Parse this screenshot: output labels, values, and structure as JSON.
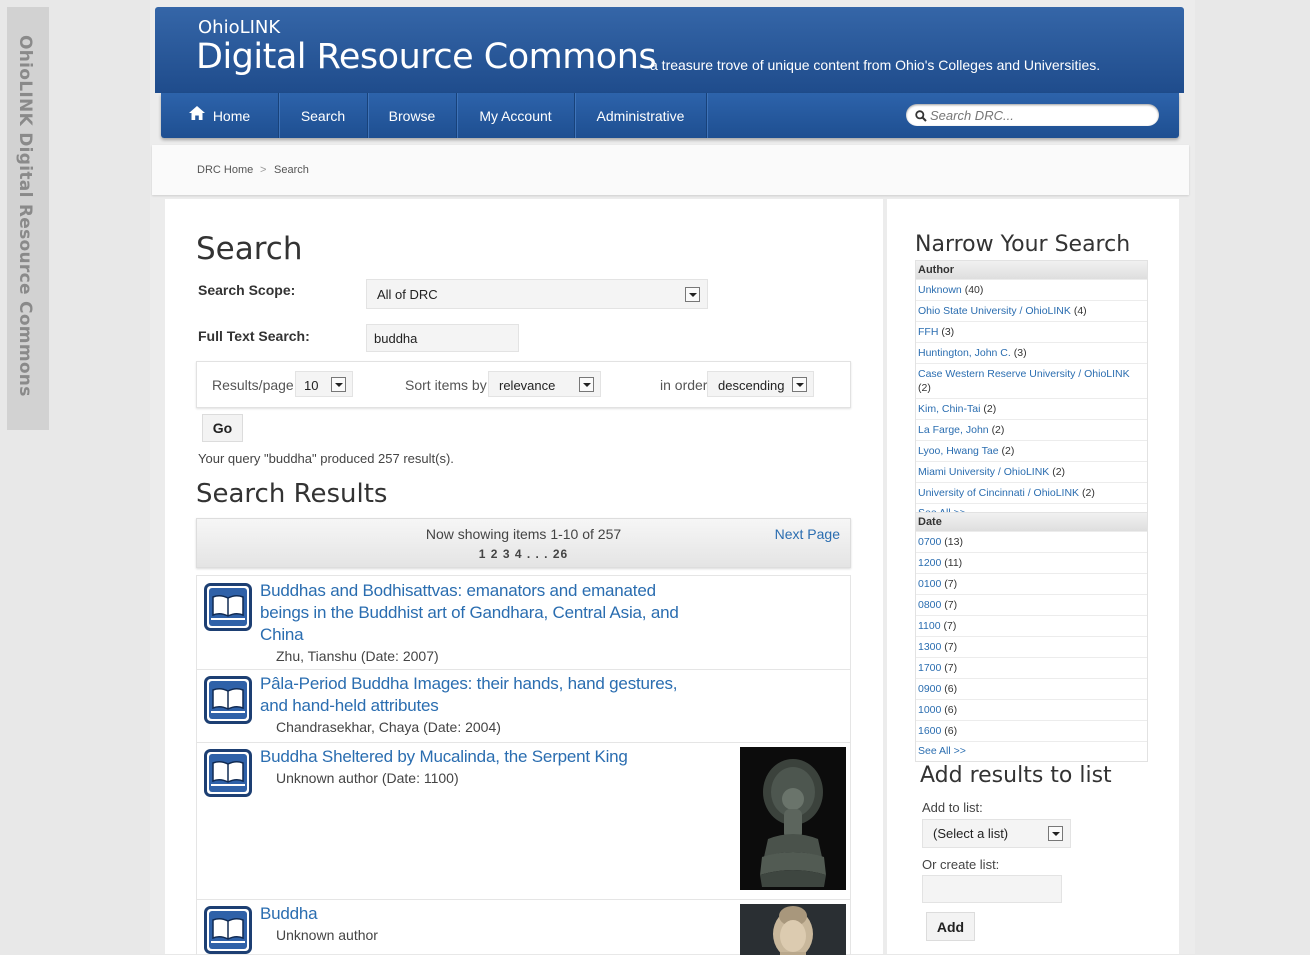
{
  "side_tab": {
    "label": "OhioLINK Digital Resource Commons"
  },
  "header": {
    "subtitle": "OhioLINK",
    "title": "Digital Resource Commons",
    "tagline": "a treasure trove of unique content from Ohio's Colleges and Universities."
  },
  "nav": {
    "items": [
      {
        "label": "Home",
        "icon": "home-icon"
      },
      {
        "label": "Search"
      },
      {
        "label": "Browse"
      },
      {
        "label": "My Account"
      },
      {
        "label": "Administrative"
      }
    ],
    "search_placeholder": "Search DRC..."
  },
  "breadcrumb": {
    "items": [
      "DRC Home",
      "Search"
    ],
    "separator": ">"
  },
  "search_form": {
    "heading": "Search",
    "scope_label": "Search Scope:",
    "scope_value": "All of DRC",
    "fulltext_label": "Full Text Search:",
    "fulltext_value": "buddha",
    "rpp_label": "Results/page",
    "rpp_value": "10",
    "sort_label": "Sort items by",
    "sort_value": "relevance",
    "order_label": "in order",
    "order_value": "descending",
    "go_label": "Go",
    "query_summary": "Your query \"buddha\" produced 257 result(s)."
  },
  "results": {
    "heading": "Search Results",
    "showing": "Now showing items 1-10 of 257",
    "pages": "1 2 3 4 . . . 26",
    "next_label": "Next Page",
    "items": [
      {
        "title": "Buddhas and Bodhisattvas: emanators and emanated beings in the Buddhist art of Gandhara, Central Asia, and China",
        "meta": "Zhu, Tianshu (Date: 2007)"
      },
      {
        "title": "Pâla-Period Buddha Images: their hands, hand gestures, and hand-held attributes",
        "meta": "Chandrasekhar, Chaya (Date: 2004)"
      },
      {
        "title": "Buddha Sheltered by Mucalinda, the Serpent King",
        "meta": "Unknown author (Date: 1100)"
      },
      {
        "title": "Buddha",
        "meta": "Unknown author"
      }
    ]
  },
  "narrow": {
    "heading": "Narrow Your Search",
    "author": {
      "label": "Author",
      "items": [
        {
          "name": "Unknown",
          "count": "(40)"
        },
        {
          "name": "Ohio State University / OhioLINK",
          "count": "(4)"
        },
        {
          "name": "FFH",
          "count": "(3)"
        },
        {
          "name": "Huntington, John C.",
          "count": "(3)"
        },
        {
          "name": "Case Western Reserve University / OhioLINK",
          "count": "(2)"
        },
        {
          "name": "Kim, Chin-Tai",
          "count": "(2)"
        },
        {
          "name": "La Farge, John",
          "count": "(2)"
        },
        {
          "name": "Lyoo, Hwang Tae",
          "count": "(2)"
        },
        {
          "name": "Miami University / OhioLINK",
          "count": "(2)"
        },
        {
          "name": "University of Cincinnati / OhioLINK",
          "count": "(2)"
        }
      ],
      "see_all": "See All >>"
    },
    "date": {
      "label": "Date",
      "items": [
        {
          "name": "0700",
          "count": "(13)"
        },
        {
          "name": "1200",
          "count": "(11)"
        },
        {
          "name": "0100",
          "count": "(7)"
        },
        {
          "name": "0800",
          "count": "(7)"
        },
        {
          "name": "1100",
          "count": "(7)"
        },
        {
          "name": "1300",
          "count": "(7)"
        },
        {
          "name": "1700",
          "count": "(7)"
        },
        {
          "name": "0900",
          "count": "(6)"
        },
        {
          "name": "1000",
          "count": "(6)"
        },
        {
          "name": "1600",
          "count": "(6)"
        }
      ],
      "see_all": "See All >>"
    }
  },
  "list": {
    "heading": "Add results to list",
    "add_to_label": "Add to list:",
    "select_value": "(Select a list)",
    "create_label": "Or create list:",
    "add_button": "Add"
  },
  "colors": {
    "header_blue": "#2a5a9c",
    "link_blue": "#2a6db0"
  }
}
